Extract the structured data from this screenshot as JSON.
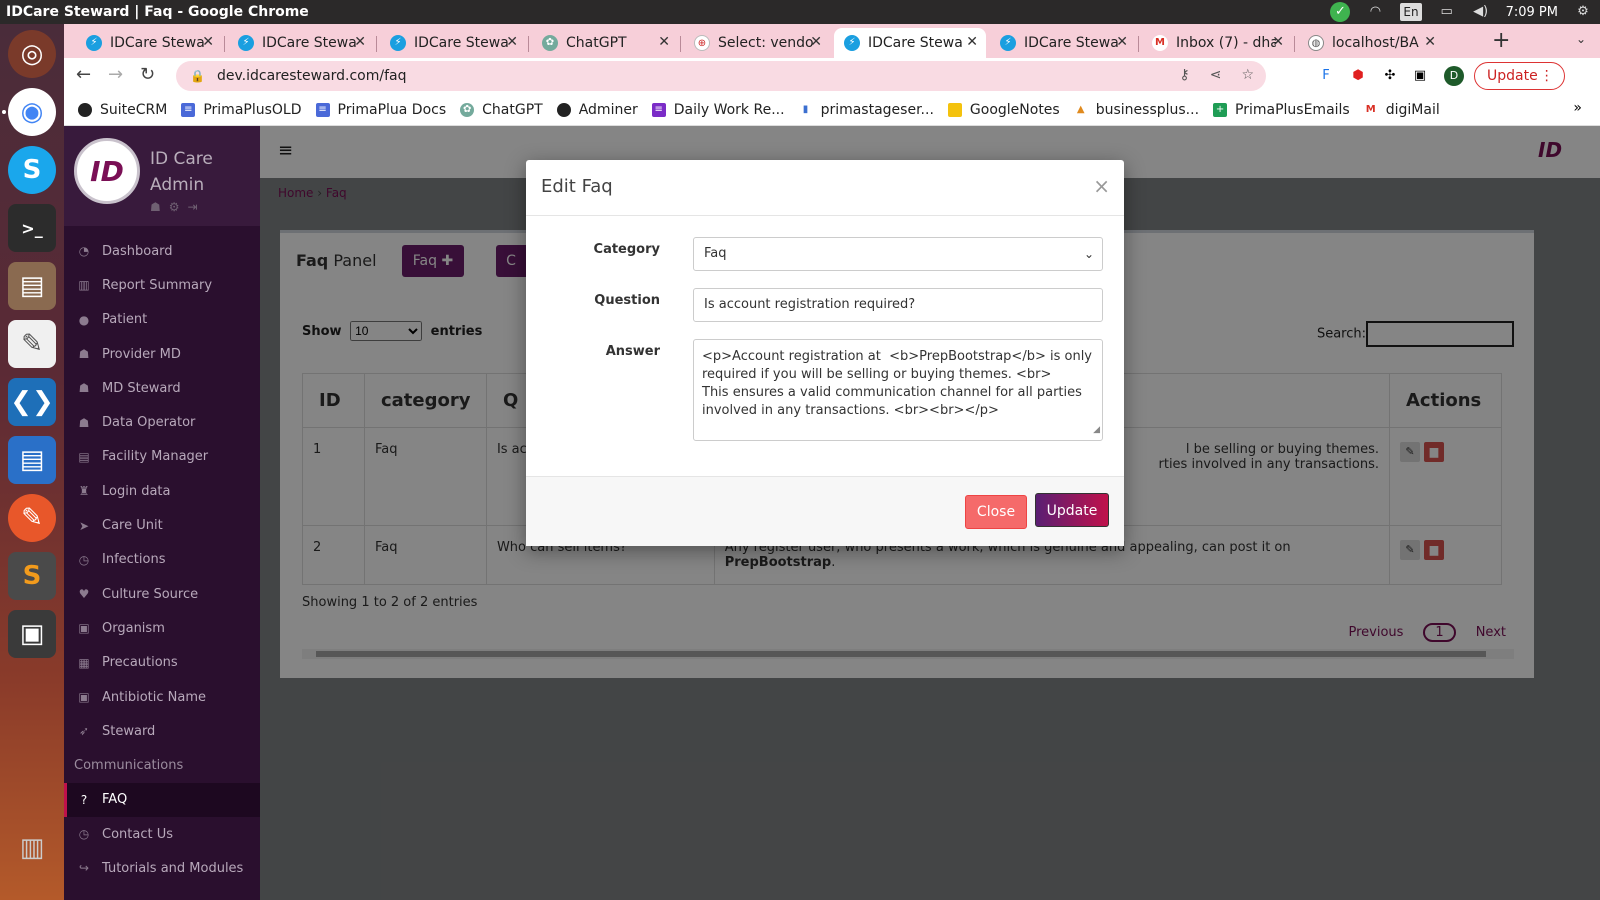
{
  "os": {
    "window_title": "IDCare Steward | Faq - Google Chrome",
    "language": "En",
    "clock": "7:09 PM"
  },
  "browser": {
    "tabs": [
      {
        "label": "IDCare Stewa",
        "active": false
      },
      {
        "label": "IDCare Stewa",
        "active": false
      },
      {
        "label": "IDCare Stewa",
        "active": false
      },
      {
        "label": "ChatGPT",
        "active": false
      },
      {
        "label": "Select: vendo",
        "active": false
      },
      {
        "label": "IDCare Stewa",
        "active": true
      },
      {
        "label": "IDCare Stewa",
        "active": false
      },
      {
        "label": "Inbox (7) - dha",
        "active": false
      },
      {
        "label": "localhost/BA",
        "active": false
      }
    ],
    "url": "dev.idcaresteward.com/faq",
    "update_label": "Update",
    "profile_initial": "D",
    "bookmarks": [
      {
        "label": "SuiteCRM",
        "color": "#222222"
      },
      {
        "label": "PrimaPlusOLD",
        "color": "#4a69d8"
      },
      {
        "label": "PrimaPlua Docs",
        "color": "#4a69d8"
      },
      {
        "label": "ChatGPT",
        "color": "#74aa9c"
      },
      {
        "label": "Adminer",
        "color": "#222222"
      },
      {
        "label": "Daily Work Re...",
        "color": "#7b2cc7"
      },
      {
        "label": "primastageser...",
        "color": "#3b6fd0"
      },
      {
        "label": "GoogleNotes",
        "color": "#f4c20d"
      },
      {
        "label": "businessplus...",
        "color": "#e08a1e"
      },
      {
        "label": "PrimaPlusEmails",
        "color": "#1f9d55"
      },
      {
        "label": "digiMail",
        "color": "#d93025"
      }
    ]
  },
  "app": {
    "brand_title": "ID Care Admin",
    "logo_text": "ID",
    "nav": [
      {
        "label": "Dashboard",
        "icon": "dashboard-icon",
        "glyph": "◔"
      },
      {
        "label": "Report Summary",
        "icon": "bar-chart-icon",
        "glyph": "▥"
      },
      {
        "label": "Patient",
        "icon": "user-circle-icon",
        "glyph": "●"
      },
      {
        "label": "Provider MD",
        "icon": "user-md-icon",
        "glyph": "☗"
      },
      {
        "label": "MD Steward",
        "icon": "user-icon",
        "glyph": "☗"
      },
      {
        "label": "Data Operator",
        "icon": "user-icon",
        "glyph": "☗"
      },
      {
        "label": "Facility Manager",
        "icon": "building-icon",
        "glyph": "▤"
      },
      {
        "label": "Login data",
        "icon": "trophy-icon",
        "glyph": "♜"
      },
      {
        "label": "Care Unit",
        "icon": "plane-icon",
        "glyph": "➤"
      },
      {
        "label": "Infections",
        "icon": "clock-icon",
        "glyph": "◷"
      },
      {
        "label": "Culture Source",
        "icon": "heartbeat-icon",
        "glyph": "♥"
      },
      {
        "label": "Organism",
        "icon": "image-icon",
        "glyph": "▣"
      },
      {
        "label": "Precautions",
        "icon": "save-icon",
        "glyph": "▦"
      },
      {
        "label": "Antibiotic Name",
        "icon": "image-icon",
        "glyph": "▣"
      },
      {
        "label": "Steward",
        "icon": "send-icon",
        "glyph": "➶"
      }
    ],
    "nav_section_header": "Communications",
    "nav_comm": [
      {
        "label": "FAQ",
        "icon": "question-icon",
        "glyph": "?",
        "active": true
      },
      {
        "label": "Contact Us",
        "icon": "clock-icon",
        "glyph": "◷",
        "active": false
      },
      {
        "label": "Tutorials and Modules",
        "icon": "share-icon",
        "glyph": "↪",
        "active": false
      }
    ],
    "breadcrumb": {
      "home": "Home",
      "current": "Faq"
    },
    "panel": {
      "title_bold": "Faq",
      "title_rest": "Panel",
      "faq_button": "Faq",
      "c_button": "C",
      "show_label": "Show",
      "entries_value": "10",
      "entries_label": "entries",
      "search_label": "Search:"
    },
    "table": {
      "headers": [
        "ID",
        "category",
        "Q",
        "Actions"
      ],
      "rows": [
        {
          "id": "1",
          "category": "Faq",
          "question": "Is ac",
          "answer": "l be selling or buying themes.\nrties involved in any transactions."
        },
        {
          "id": "2",
          "category": "Faq",
          "question": "Who can sell items?",
          "answer_pre": "Any register user, who presents a work, which is genuine and appealing, can post it on ",
          "answer_bold": "PrepBootstrap",
          "answer_post": "."
        }
      ],
      "showing": "Showing 1 to 2 of 2 entries",
      "prev": "Previous",
      "page": "1",
      "next": "Next"
    }
  },
  "modal": {
    "title": "Edit Faq",
    "close_x": "×",
    "category_label": "Category",
    "category_value": "Faq",
    "question_label": "Question",
    "question_value": "Is account registration required?",
    "answer_label": "Answer",
    "answer_value": "<p>Account registration at  <b>PrepBootstrap</b> is only\nrequired if you will be selling or buying themes. <br>\nThis ensures a valid communication channel for all parties\ninvolved in any transactions. <br><br></p>",
    "close_button": "Close",
    "update_button": "Update"
  }
}
